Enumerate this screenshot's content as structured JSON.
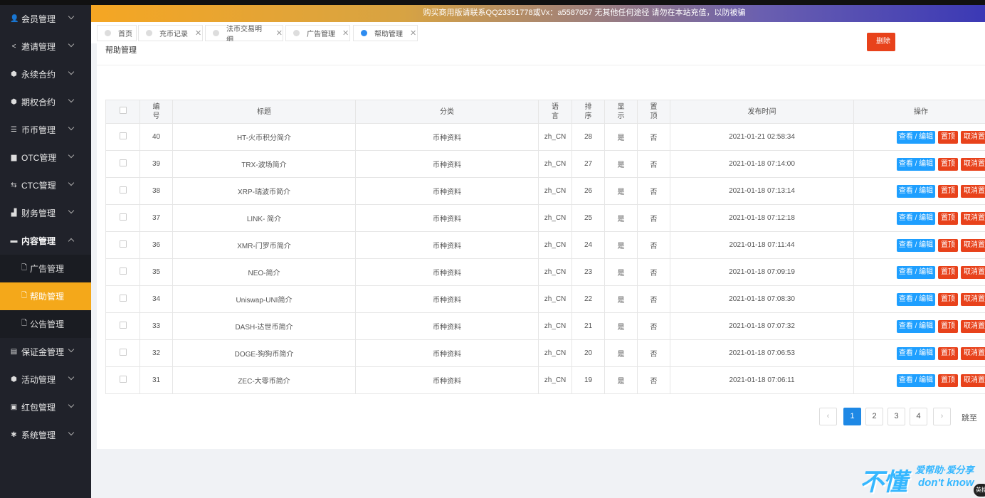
{
  "sidebar": {
    "items": [
      {
        "icon": "user-icon",
        "glyph": "👤",
        "label": "会员管理"
      },
      {
        "icon": "share-icon",
        "glyph": "<",
        "label": "邀请管理"
      },
      {
        "icon": "cube-icon",
        "glyph": "⬢",
        "label": "永续合约"
      },
      {
        "icon": "cube-icon",
        "glyph": "⬢",
        "label": "期权合约"
      },
      {
        "icon": "sliders-icon",
        "glyph": "☰",
        "label": "币币管理"
      },
      {
        "icon": "briefcase-icon",
        "glyph": "▆",
        "label": "OTC管理"
      },
      {
        "icon": "exchange-icon",
        "glyph": "⇆",
        "label": "CTC管理"
      },
      {
        "icon": "bar-chart-icon",
        "glyph": "▟",
        "label": "财务管理"
      },
      {
        "icon": "folder-icon",
        "glyph": "▬",
        "label": "内容管理"
      }
    ],
    "subitems": [
      {
        "label": "广告管理"
      },
      {
        "label": "帮助管理"
      },
      {
        "label": "公告管理"
      }
    ],
    "items2": [
      {
        "icon": "card-icon",
        "glyph": "▤",
        "label": "保证金管理"
      },
      {
        "icon": "cube-icon",
        "glyph": "⬢",
        "label": "活动管理"
      },
      {
        "icon": "wallet-icon",
        "glyph": "▣",
        "label": "红包管理"
      },
      {
        "icon": "gear-icon",
        "glyph": "✱",
        "label": "系统管理"
      }
    ]
  },
  "banner": {
    "text": "购买商用版请联系QQ23351778或Vx：a5587057 无其他任何途径 请勿在本站充值，以防被骗"
  },
  "tabs": [
    {
      "label": "首页"
    },
    {
      "label": "充币记录"
    },
    {
      "label": "法币交易明细"
    },
    {
      "label": "广告管理"
    },
    {
      "label": "帮助管理"
    }
  ],
  "page": {
    "title": "帮助管理",
    "delete_label": "删除"
  },
  "table": {
    "headers": {
      "id": "编\n号",
      "title": "标题",
      "category": "分类",
      "lang": "语\n言",
      "sort": "排\n序",
      "show": "显\n示",
      "top": "置\n顶",
      "time": "发布时间",
      "ops": "操作"
    },
    "rows": [
      {
        "id": "40",
        "title": "HT-火币积分简介",
        "category": "币种资料",
        "lang": "zh_CN",
        "sort": "28",
        "show": "是",
        "top": "否",
        "time": "2021-01-21 02:58:34"
      },
      {
        "id": "39",
        "title": "TRX-波场简介",
        "category": "币种资料",
        "lang": "zh_CN",
        "sort": "27",
        "show": "是",
        "top": "否",
        "time": "2021-01-18 07:14:00"
      },
      {
        "id": "38",
        "title": "XRP-瑞波币简介",
        "category": "币种资料",
        "lang": "zh_CN",
        "sort": "26",
        "show": "是",
        "top": "否",
        "time": "2021-01-18 07:13:14"
      },
      {
        "id": "37",
        "title": "LINK- 简介",
        "category": "币种资料",
        "lang": "zh_CN",
        "sort": "25",
        "show": "是",
        "top": "否",
        "time": "2021-01-18 07:12:18"
      },
      {
        "id": "36",
        "title": "XMR-门罗币简介",
        "category": "币种资料",
        "lang": "zh_CN",
        "sort": "24",
        "show": "是",
        "top": "否",
        "time": "2021-01-18 07:11:44"
      },
      {
        "id": "35",
        "title": "NEO-简介",
        "category": "币种资料",
        "lang": "zh_CN",
        "sort": "23",
        "show": "是",
        "top": "否",
        "time": "2021-01-18 07:09:19"
      },
      {
        "id": "34",
        "title": "Uniswap-UNI简介",
        "category": "币种资料",
        "lang": "zh_CN",
        "sort": "22",
        "show": "是",
        "top": "否",
        "time": "2021-01-18 07:08:30"
      },
      {
        "id": "33",
        "title": "DASH-达世币简介",
        "category": "币种资料",
        "lang": "zh_CN",
        "sort": "21",
        "show": "是",
        "top": "否",
        "time": "2021-01-18 07:07:32"
      },
      {
        "id": "32",
        "title": "DOGE-狗狗币简介",
        "category": "币种资料",
        "lang": "zh_CN",
        "sort": "20",
        "show": "是",
        "top": "否",
        "time": "2021-01-18 07:06:53"
      },
      {
        "id": "31",
        "title": "ZEC-大零币简介",
        "category": "币种资料",
        "lang": "zh_CN",
        "sort": "19",
        "show": "是",
        "top": "否",
        "time": "2021-01-18 07:06:11"
      }
    ],
    "actions": {
      "view": "查看 / 编辑",
      "top": "置顶",
      "cancel": "取消置顶"
    }
  },
  "pagination": {
    "prev": "‹",
    "pages": [
      "1",
      "2",
      "3",
      "4"
    ],
    "current": "1",
    "next": "›",
    "jump_label": "跳至"
  },
  "watermark": {
    "big": "不懂",
    "line1": "爱帮助·爱分享",
    "line2": "don't know",
    "badge": "英搜"
  },
  "colors": {
    "sidebar": "#20222a",
    "active": "#f4a81a",
    "primary": "#1e9fff",
    "danger": "#e8421b"
  }
}
